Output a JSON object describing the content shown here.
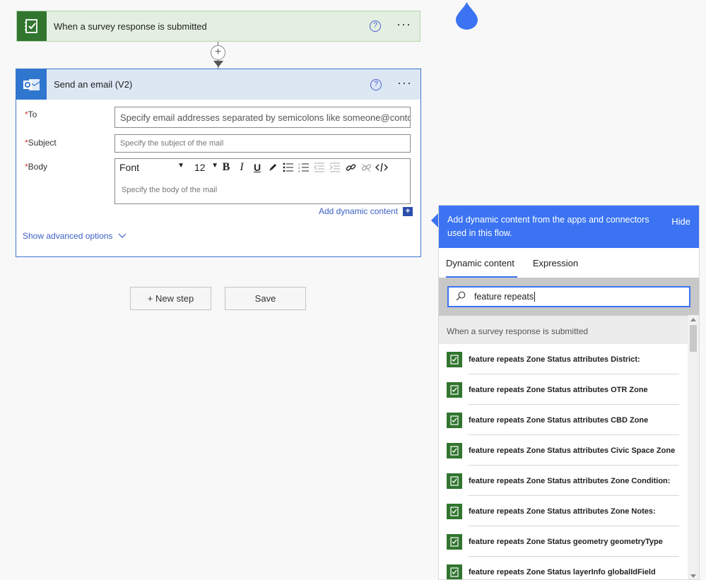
{
  "trigger": {
    "title": "When a survey response is submitted",
    "help": "?",
    "more": "···"
  },
  "email_action": {
    "title": "Send an email (V2)",
    "help": "?",
    "more": "···",
    "to_label": "To",
    "to_placeholder": "Specify email addresses separated by semicolons like someone@contoso.com",
    "subject_label": "Subject",
    "subject_placeholder": "Specify the subject of the mail",
    "body_label": "Body",
    "body_placeholder": "Specify the body of the mail",
    "font_value": "Font",
    "font_size_value": "12",
    "add_dynamic_label": "Add dynamic content",
    "show_advanced_label": "Show advanced options"
  },
  "actions": {
    "new_step_label": "+ New step",
    "save_label": "Save"
  },
  "dynamic_panel": {
    "header_text": "Add dynamic content from the apps and connectors used in this flow.",
    "hide_label": "Hide",
    "tabs": [
      "Dynamic content",
      "Expression"
    ],
    "search_value": "feature repeats",
    "section_title": "When a survey response is submitted",
    "items": [
      "feature repeats Zone Status attributes District:",
      "feature repeats Zone Status attributes OTR Zone",
      "feature repeats Zone Status attributes CBD Zone",
      "feature repeats Zone Status attributes Civic Space Zone",
      "feature repeats Zone Status attributes Zone Condition:",
      "feature repeats Zone Status attributes Zone Notes:",
      "feature repeats Zone Status geometry geometryType",
      "feature repeats Zone Status layerInfo globalIdField"
    ]
  },
  "colors": {
    "survey_green": "#31752f",
    "outlook_blue": "#2f76cf",
    "accent_blue": "#3b73f2",
    "link_blue": "#3d5fc4",
    "required_red": "#d13438"
  },
  "icons": {
    "trigger": "survey123-icon",
    "email": "outlook-icon",
    "drop": "water-drop-icon",
    "search": "search-icon"
  }
}
